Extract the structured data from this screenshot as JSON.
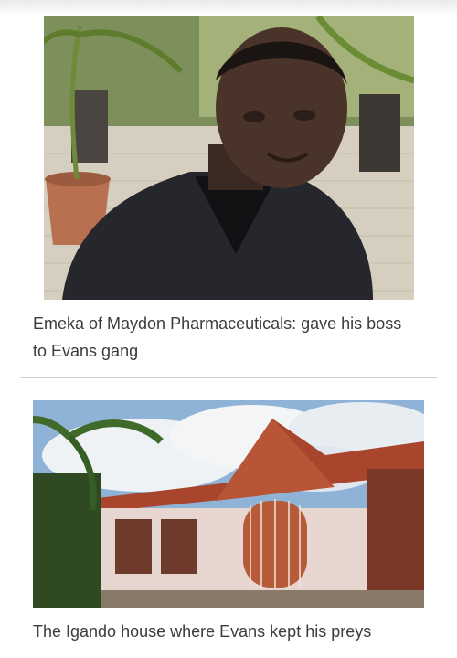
{
  "articles": [
    {
      "image_subject": "Portrait of a man in a dark suit outdoors with potted palm trees and a paved courtyard",
      "caption": "Emeka of Maydon Pharmaceuticals: gave his boss to Evans gang"
    },
    {
      "image_subject": "Single-storey house with red tiled roof, arched doorway and cloudy sky",
      "caption": "The Igando house where Evans kept his preys"
    }
  ]
}
